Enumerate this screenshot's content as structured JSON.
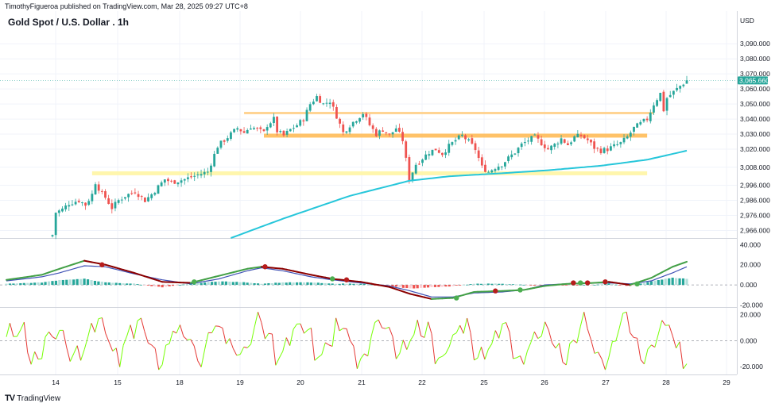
{
  "header": {
    "publish_line": "TimothyFigueroa published on TradingView.com, Mar 28, 2025 09:27 UTC+8",
    "symbol_title": "Gold Spot / U.S. Dollar . 1h",
    "currency": "USD"
  },
  "footer": {
    "brand_text": "TradingView",
    "logo_text": "TV"
  },
  "colors": {
    "up": "#26a69a",
    "down": "#ef5350",
    "ema": "#26c6da",
    "res_upper": "#ffcc80",
    "res_mid": "#ffb74d",
    "support": "#fff59d",
    "macd_fast": "#43a047",
    "macd_slow": "#3f51b5",
    "macd_dot_up": "#4caf50",
    "macd_dot_down": "#b71c1c",
    "osc_up": "#76ff03",
    "osc_down": "#e53935",
    "price_tag": "#26a69a",
    "grid": "#f0f3fa"
  },
  "chart_data": [
    {
      "type": "candlestick",
      "title": "Gold Spot / U.S. Dollar . 1h",
      "xlabel": "",
      "ylabel": "",
      "x_tick_labels": [
        "14",
        "15",
        "18",
        "19",
        "20",
        "21",
        "22",
        "25",
        "26",
        "27",
        "28",
        "29"
      ],
      "y_tick_labels": [
        "3,090.000",
        "3,080.000",
        "3,070.000",
        "3,060.000",
        "3,050.000",
        "3,040.000",
        "3,030.000",
        "3,020.000",
        "3,008.000",
        "2,996.000",
        "2,986.000",
        "2,976.000",
        "2,966.000"
      ],
      "y_tick_values": [
        3090,
        3080,
        3070,
        3060,
        3050,
        3040,
        3030,
        3020,
        3008,
        2996,
        2986,
        2976,
        2966
      ],
      "ylim": [
        2961,
        3098
      ],
      "last_price": "3,065.660",
      "last_price_value": 3065.66,
      "price_path": [
        [
          0,
          2963
        ],
        [
          1,
          2978
        ],
        [
          3,
          2980
        ],
        [
          5,
          2984
        ],
        [
          8,
          2986
        ],
        [
          10,
          2983
        ],
        [
          12,
          2990
        ],
        [
          13,
          2998
        ],
        [
          14,
          2994
        ],
        [
          15,
          2990
        ],
        [
          16,
          2988
        ],
        [
          18,
          2981
        ],
        [
          20,
          2986
        ],
        [
          22,
          2989
        ],
        [
          25,
          2992
        ],
        [
          28,
          2986
        ],
        [
          30,
          2990
        ],
        [
          32,
          2995
        ],
        [
          34,
          3000
        ],
        [
          36,
          2998
        ],
        [
          40,
          3000
        ],
        [
          44,
          3003
        ],
        [
          47,
          3005
        ],
        [
          50,
          3022
        ],
        [
          53,
          3028
        ],
        [
          56,
          3034
        ],
        [
          58,
          3031
        ],
        [
          60,
          3035
        ],
        [
          62,
          3033
        ],
        [
          64,
          3031
        ],
        [
          65,
          3036
        ],
        [
          67,
          3040
        ],
        [
          68,
          3032
        ],
        [
          70,
          3029
        ],
        [
          72,
          3033
        ],
        [
          74,
          3036
        ],
        [
          76,
          3040
        ],
        [
          78,
          3050
        ],
        [
          80,
          3055
        ],
        [
          82,
          3050
        ],
        [
          84,
          3052
        ],
        [
          86,
          3042
        ],
        [
          88,
          3031
        ],
        [
          90,
          3036
        ],
        [
          92,
          3040
        ],
        [
          94,
          3044
        ],
        [
          96,
          3036
        ],
        [
          98,
          3030
        ],
        [
          100,
          3033
        ],
        [
          102,
          3029
        ],
        [
          104,
          3034
        ],
        [
          106,
          3026
        ],
        [
          108,
          3000
        ],
        [
          110,
          3010
        ],
        [
          112,
          3014
        ],
        [
          114,
          3018
        ],
        [
          116,
          3020
        ],
        [
          118,
          3017
        ],
        [
          120,
          3022
        ],
        [
          122,
          3026
        ],
        [
          124,
          3029
        ],
        [
          126,
          3025
        ],
        [
          128,
          3020
        ],
        [
          130,
          3008
        ],
        [
          132,
          3005
        ],
        [
          134,
          3008
        ],
        [
          136,
          3010
        ],
        [
          138,
          3014
        ],
        [
          140,
          3018
        ],
        [
          142,
          3023
        ],
        [
          144,
          3026
        ],
        [
          146,
          3028
        ],
        [
          148,
          3024
        ],
        [
          150,
          3020
        ],
        [
          152,
          3023
        ],
        [
          154,
          3027
        ],
        [
          156,
          3023
        ],
        [
          158,
          3028
        ],
        [
          160,
          3029
        ],
        [
          162,
          3026
        ],
        [
          164,
          3021
        ],
        [
          166,
          3019
        ],
        [
          168,
          3020
        ],
        [
          170,
          3022
        ],
        [
          172,
          3024
        ],
        [
          174,
          3028
        ],
        [
          176,
          3034
        ],
        [
          178,
          3037
        ],
        [
          180,
          3040
        ],
        [
          182,
          3050
        ],
        [
          184,
          3057
        ],
        [
          185,
          3046
        ],
        [
          186,
          3054
        ],
        [
          188,
          3058
        ],
        [
          190,
          3062
        ],
        [
          192,
          3065.66
        ]
      ],
      "ema_path": [
        [
          54,
          2961
        ],
        [
          70,
          2974
        ],
        [
          90,
          2989
        ],
        [
          108,
          2999
        ],
        [
          120,
          3002
        ],
        [
          136,
          3004
        ],
        [
          150,
          3006
        ],
        [
          166,
          3009
        ],
        [
          180,
          3013
        ],
        [
          192,
          3019
        ]
      ],
      "levels": [
        {
          "name": "upper-resistance",
          "value": 3044,
          "from": 58,
          "to": 182
        },
        {
          "name": "mid-resistance",
          "value": 3029,
          "from": 64,
          "to": 180
        },
        {
          "name": "support",
          "value": 3004,
          "from": 12,
          "to": 180
        }
      ]
    },
    {
      "type": "line",
      "name_pane": "macd",
      "y_tick_labels": [
        "40.000",
        "20.000",
        "0.000",
        "-20.000"
      ],
      "y_tick_values": [
        40,
        20,
        0,
        -20
      ],
      "ylim": [
        -22,
        45
      ],
      "series": [
        {
          "values_path": [
            [
              0,
              5
            ],
            [
              10,
              10
            ],
            [
              15,
              16
            ],
            [
              22,
              24
            ],
            [
              28,
              20
            ],
            [
              36,
              12
            ],
            [
              44,
              3
            ],
            [
              52,
              2
            ],
            [
              60,
              9
            ],
            [
              68,
              16
            ],
            [
              72,
              18
            ],
            [
              78,
              16
            ],
            [
              86,
              10
            ],
            [
              92,
              6
            ],
            [
              100,
              3
            ],
            [
              108,
              -2
            ],
            [
              114,
              -9
            ],
            [
              120,
              -14
            ],
            [
              126,
              -13
            ],
            [
              132,
              -7
            ],
            [
              140,
              -6
            ],
            [
              146,
              -5
            ],
            [
              152,
              -1
            ],
            [
              158,
              1
            ],
            [
              166,
              2
            ],
            [
              170,
              3
            ],
            [
              176,
              0
            ],
            [
              182,
              7
            ],
            [
              188,
              18
            ],
            [
              192,
              23
            ]
          ]
        },
        {
          "values_path": [
            [
              0,
              4
            ],
            [
              10,
              8
            ],
            [
              15,
              12
            ],
            [
              22,
              19
            ],
            [
              28,
              18
            ],
            [
              36,
              11
            ],
            [
              44,
              5
            ],
            [
              52,
              1
            ],
            [
              60,
              6
            ],
            [
              68,
              14
            ],
            [
              72,
              17
            ],
            [
              78,
              14
            ],
            [
              86,
              8
            ],
            [
              92,
              5
            ],
            [
              100,
              2
            ],
            [
              108,
              -1
            ],
            [
              114,
              -6
            ],
            [
              120,
              -12
            ],
            [
              126,
              -12
            ],
            [
              132,
              -8
            ],
            [
              140,
              -7
            ],
            [
              146,
              -5
            ],
            [
              152,
              0
            ],
            [
              158,
              1
            ],
            [
              166,
              2
            ],
            [
              170,
              2
            ],
            [
              176,
              1
            ],
            [
              182,
              4
            ],
            [
              188,
              12
            ],
            [
              192,
              18
            ]
          ]
        }
      ],
      "cross_points": [
        {
          "x": 27,
          "y": 20,
          "dir": "down"
        },
        {
          "x": 53,
          "y": 3,
          "dir": "up"
        },
        {
          "x": 73,
          "y": 18,
          "dir": "down"
        },
        {
          "x": 92,
          "y": 6,
          "dir": "up"
        },
        {
          "x": 96,
          "y": 5,
          "dir": "down"
        },
        {
          "x": 127,
          "y": -13,
          "dir": "up"
        },
        {
          "x": 138,
          "y": -6,
          "dir": "down"
        },
        {
          "x": 145,
          "y": -5,
          "dir": "up"
        },
        {
          "x": 160,
          "y": 2,
          "dir": "down"
        },
        {
          "x": 162,
          "y": 2,
          "dir": "up"
        },
        {
          "x": 164,
          "y": 2,
          "dir": "down"
        },
        {
          "x": 169,
          "y": 3,
          "dir": "down"
        },
        {
          "x": 178,
          "y": 1,
          "dir": "up"
        }
      ]
    },
    {
      "type": "line",
      "name_pane": "oscillator",
      "y_tick_labels": [
        "20.000",
        "0.000",
        "-20.000"
      ],
      "y_tick_values": [
        20,
        0,
        -20
      ],
      "ylim": [
        -26,
        24
      ]
    }
  ]
}
